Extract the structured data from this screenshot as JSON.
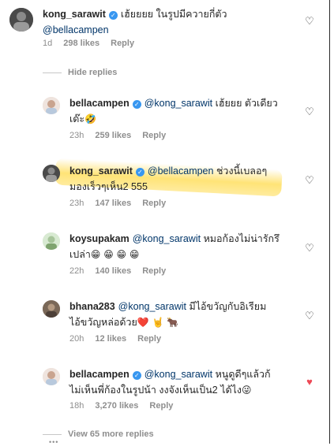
{
  "main_comment": {
    "username": "kong_sarawit",
    "text": "เฮ้ยยยย ในรูปมีควายกี่ตัว",
    "mention": "@bellacampen",
    "time": "1d",
    "likes": "298 likes",
    "reply": "Reply"
  },
  "hide_replies": "Hide replies",
  "replies": [
    {
      "username": "bellacampen",
      "mention": "@kong_sarawit",
      "text_line1": "เฮ้ยยย ตัวเดียว",
      "text_line2": "เด๊ะ",
      "emoji": "🤣",
      "time": "23h",
      "likes": "259 likes",
      "reply": "Reply"
    },
    {
      "username": "kong_sarawit",
      "mention": "@bellacampen",
      "text_line1": "ช่วงนี้เบลอๆ",
      "text_line2": "มองเร็วๆเห็น2 555",
      "time": "23h",
      "likes": "147 likes",
      "reply": "Reply"
    },
    {
      "username": "koysupakam",
      "mention": "@kong_sarawit",
      "text_line1": "หมอก้องไม่น่ารักรึ",
      "text_line2": "เปล่า",
      "emoji": "😁 😁 😁 😁",
      "time": "22h",
      "likes": "140 likes",
      "reply": "Reply"
    },
    {
      "username": "bhana283",
      "mention": "@kong_sarawit",
      "text_line1": "มีไอ้ขวัญกับอิเรียม",
      "text_line2": "ไอ้ขวัญหล่อด้วย",
      "emoji": "❤️ 🤘 🐂",
      "time": "20h",
      "likes": "12 likes",
      "reply": "Reply"
    },
    {
      "username": "bellacampen",
      "mention": "@kong_sarawit",
      "text_line1": "หนูดูดีๆแล้วก้",
      "text_line2": "ไม่เห็นพี่ก้องในรูปน้า งงจังเห็นเป็น2 ได้ไง",
      "emoji": "😜",
      "time": "18h",
      "likes": "3,270 likes",
      "reply": "Reply"
    }
  ],
  "view_more": "View 65 more replies",
  "colors": {
    "text": "#262626",
    "meta": "#8e8e8e",
    "verified": "#3897f0",
    "heart_liked": "#ed4956",
    "highlight": "#ffdb4d"
  },
  "icons": {
    "heart": "heart-icon",
    "verified": "verified-badge-icon"
  }
}
